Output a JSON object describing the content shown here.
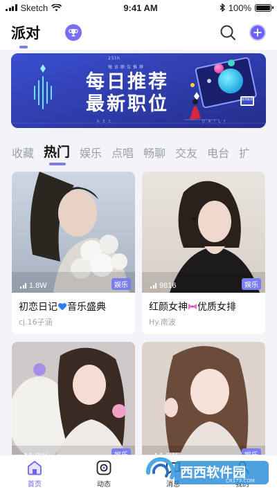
{
  "status_bar": {
    "carrier": "Sketch",
    "time": "9:41 AM",
    "battery": "100%"
  },
  "header": {
    "title": "派对"
  },
  "banner": {
    "tag": "25th",
    "sub": "每日职位推荐",
    "title_line1": "每日推荐",
    "title_line2": "最新职位",
    "footer_left": "REC",
    "footer_right": "DAILY",
    "badge": "推荐推荐"
  },
  "tabs": [
    {
      "label": "收藏",
      "active": false
    },
    {
      "label": "热门",
      "active": true
    },
    {
      "label": "娱乐",
      "active": false
    },
    {
      "label": "点唱",
      "active": false
    },
    {
      "label": "畅聊",
      "active": false
    },
    {
      "label": "交友",
      "active": false
    },
    {
      "label": "电台",
      "active": false
    },
    {
      "label": "扩",
      "active": false
    }
  ],
  "cards": [
    {
      "views": "1.8W",
      "category": "娱乐",
      "title_a": "初恋日记",
      "title_b": "音乐盛典",
      "author": "cj.16子涵",
      "heart_color": "#2f7df6"
    },
    {
      "views": "9816",
      "category": "娱乐",
      "title_a": "红颜女神",
      "title_b": "优质女排",
      "author": "Hy.南波",
      "heart_color": "#e870c8"
    },
    {
      "views": "1.8W",
      "category": "娱乐"
    },
    {
      "views": "1.8W",
      "category": "娱乐"
    }
  ],
  "bottom_nav": [
    {
      "label": "首页",
      "icon": "home-icon",
      "active": true
    },
    {
      "label": "动态",
      "icon": "moments-icon",
      "active": false
    },
    {
      "label": "消息",
      "icon": "message-icon",
      "active": false
    },
    {
      "label": "我的",
      "icon": "profile-icon",
      "active": false
    }
  ],
  "watermark": {
    "text": "西西软件园",
    "url": "CR173.COM"
  },
  "colors": {
    "accent": "#7b7ef0",
    "primary": "#6d63f2",
    "background": "#f4f4f8"
  }
}
